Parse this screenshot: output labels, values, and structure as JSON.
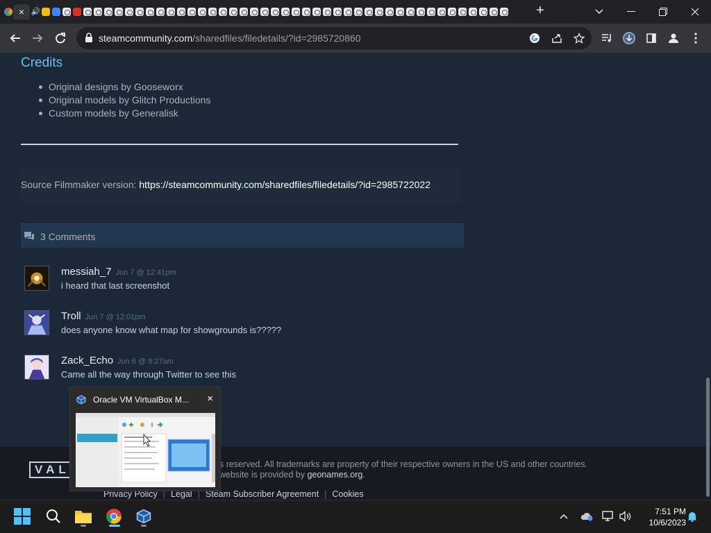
{
  "browser": {
    "active_tab_close": "×",
    "new_tab": "+",
    "url_host": "steamcommunity.com",
    "url_path": "/sharedfiles/filedetails/?id=2985720860"
  },
  "page": {
    "credits_title": "Credits",
    "credits": [
      "Original designs by Gooseworx",
      "Original models by Glitch Productions",
      "Custom models by Generalisk"
    ],
    "sfm_label": "Source Filmmaker version: ",
    "sfm_link": "https://steamcommunity.com/sharedfiles/filedetails/?id=2985722022",
    "comments_count": "3 Comments",
    "comments": [
      {
        "author": "messiah_7",
        "date": "Jun 7 @ 12:41pm",
        "text": "i heard that last screenshot"
      },
      {
        "author": "Troll",
        "date": "Jun 7 @ 12:01pm",
        "text": "does anyone know what map for showgrounds is?????"
      },
      {
        "author": "Zack_Echo",
        "date": "Jun 6 @ 8:27am",
        "text": "Came all the way through Twitter to see this"
      }
    ]
  },
  "footer": {
    "logo": "VALVE",
    "line1": "s reserved. All trademarks are property of their respective owners in the US and other countries.",
    "line2_prefix": "website is provided by ",
    "line2_link": "geonames.org",
    "line2_suffix": ".",
    "links": [
      "Privacy Policy",
      "Legal",
      "Steam Subscriber Agreement",
      "Cookies"
    ]
  },
  "preview": {
    "title": "Oracle VM VirtualBox M...",
    "close": "×"
  },
  "taskbar": {
    "time": "7:51 PM",
    "date": "10/6/2023"
  },
  "colors": {
    "steam_bg": "#1b2838",
    "link_blue": "#66c0f4",
    "comments_header": "#23364f",
    "taskbar_accent": "#60cdff"
  }
}
